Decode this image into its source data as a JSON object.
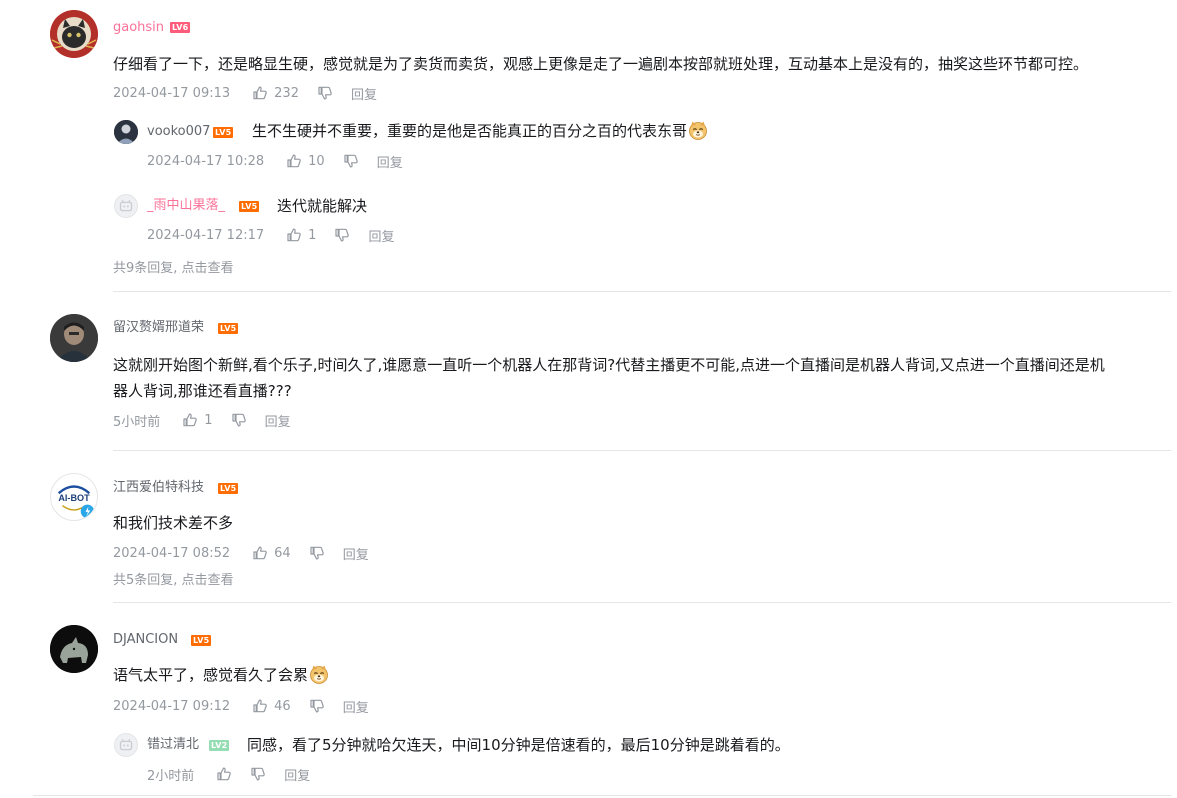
{
  "comments": [
    {
      "user": "gaohsin",
      "level": "LV6",
      "text": "仔细看了一下，还是略显生硬，感觉就是为了卖货而卖货，观感上更像是走了一遍剧本按部就班处理，互动基本上是没有的，抽奖这些环节都可控。",
      "time": "2024-04-17 09:13",
      "likes": "232",
      "reply_label": "回复",
      "replies": [
        {
          "user": "vooko007",
          "level": "LV5",
          "text": "生不生硬并不重要，重要的是他是否能真正的百分之百的代表东哥",
          "time": "2024-04-17 10:28",
          "likes": "10",
          "reply_label": "回复"
        },
        {
          "user": "_雨中山果落_",
          "level": "LV5",
          "text": "迭代就能解决",
          "time": "2024-04-17 12:17",
          "likes": "1",
          "reply_label": "回复"
        }
      ],
      "more_count": "共9条回复,",
      "more_hint": " 点击查看"
    },
    {
      "user": "留汉赘婿邢道荣",
      "level": "LV5",
      "text_line1": "这就刚开始图个新鲜,看个乐子,时间久了,谁愿意一直听一个机器人在那背词?代替主播更不可能,点进一个直播间是机器人背词,又点进一个直播间还是机",
      "text_line2": "器人背词,那谁还看直播???",
      "time": "5小时前",
      "likes": "1",
      "reply_label": "回复"
    },
    {
      "user": "江西爱伯特科技",
      "level": "LV5",
      "avatar_text": "AI-BOT",
      "text": "和我们技术差不多",
      "time": "2024-04-17 08:52",
      "likes": "64",
      "reply_label": "回复",
      "more_count": "共5条回复,",
      "more_hint": " 点击查看"
    },
    {
      "user": "DJANCION",
      "level": "LV5",
      "text": "语气太平了，感觉看久了会累",
      "time": "2024-04-17 09:12",
      "likes": "46",
      "reply_label": "回复",
      "replies": [
        {
          "user": "错过清北",
          "level": "LV2",
          "text": "同感，看了5分钟就哈欠连天，中间10分钟是倍速看的，最后10分钟是跳着看的。",
          "time": "2小时前",
          "likes": "",
          "reply_label": "回复"
        }
      ]
    }
  ],
  "colors": {
    "pink_name": "#fb7299",
    "meta_gray": "#9499a0",
    "divider": "#e3e5e7",
    "lv6": "#ff5c7c",
    "lv5": "#ff6c00",
    "lv2": "#95ddb2"
  },
  "icons": {
    "like": "thumbs-up-icon",
    "dislike": "thumbs-down-icon",
    "emoji": "doge-emoji-icon"
  }
}
